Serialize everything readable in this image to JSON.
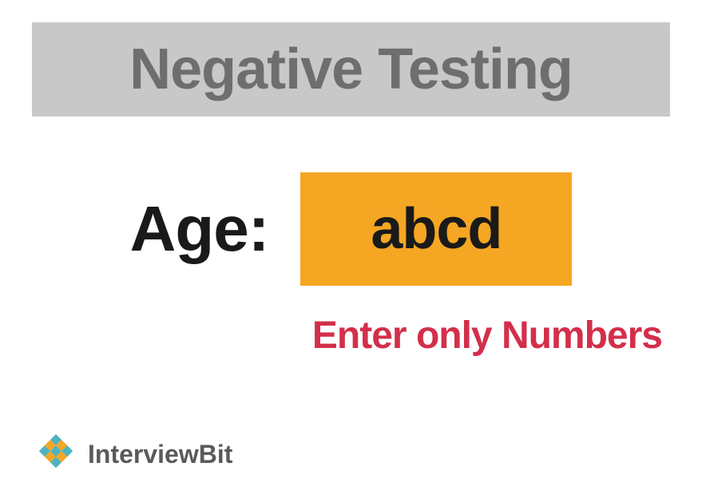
{
  "title": "Negative Testing",
  "form": {
    "age_label": "Age:",
    "age_input_value": "abcd",
    "error_message": "Enter only Numbers"
  },
  "logo": {
    "brand_part1": "Interview",
    "brand_part2": "Bit"
  },
  "colors": {
    "title_bg": "#c8c8c8",
    "title_text": "#6e6e6e",
    "input_bg": "#f5a623",
    "error_text": "#d32f4a",
    "logo_teal": "#4fb3bf",
    "logo_orange": "#f5a623"
  }
}
